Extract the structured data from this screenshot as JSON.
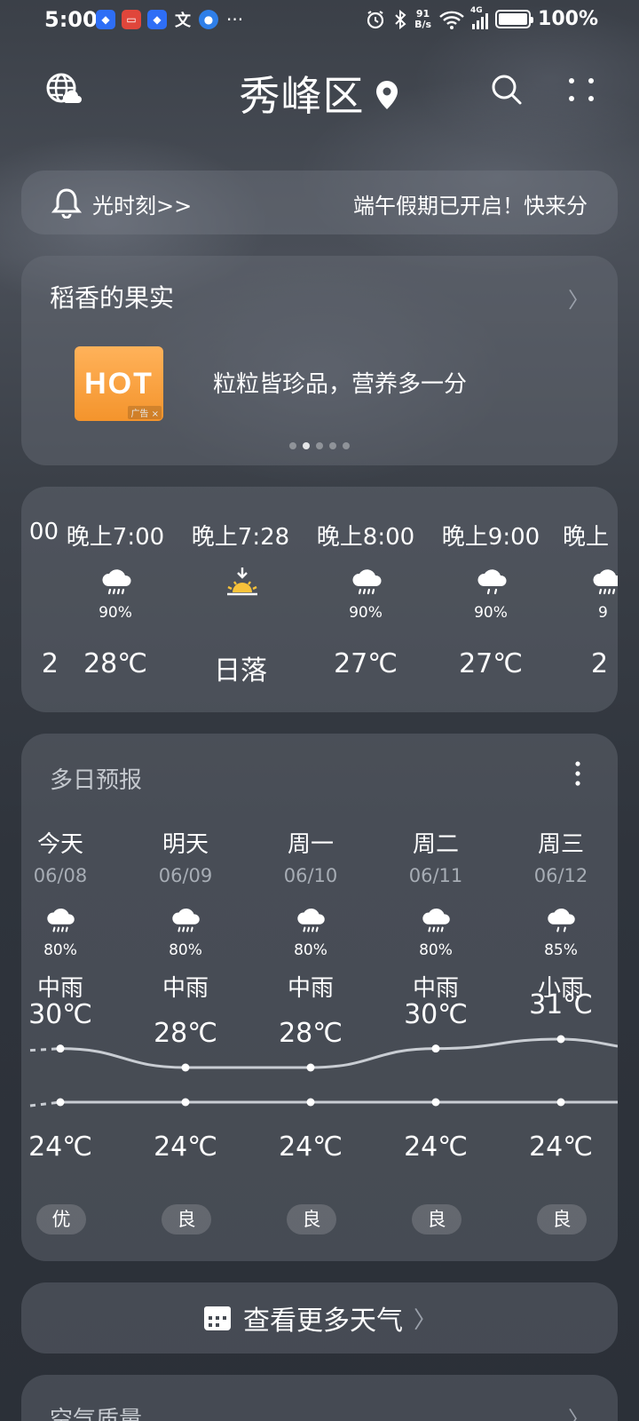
{
  "status_bar": {
    "time": "5:00",
    "net_speed_value": "91",
    "net_speed_unit": "B/s",
    "signal_label": "4G",
    "battery": "100%",
    "battery_level": 1.0
  },
  "header": {
    "title": "秀峰区"
  },
  "notice": {
    "left_text": "光时刻>>",
    "right_text": "端午假期已开启！快来分"
  },
  "ad": {
    "title": "稻香的果实",
    "thumb_text": "HOT",
    "badge": "广告 ×",
    "text": "粒粒皆珍品，营养多一分",
    "dot_count": 5,
    "active_dot": 1
  },
  "hourly": [
    {
      "time": "00",
      "pct": "",
      "temp": "2"
    },
    {
      "time": "晚上7:00",
      "icon": "rain-cloud-icon",
      "pct": "90%",
      "temp": "28℃"
    },
    {
      "time": "晚上7:28",
      "icon": "sunset-icon",
      "pct": "",
      "temp": "日落"
    },
    {
      "time": "晚上8:00",
      "icon": "rain-cloud-icon",
      "pct": "90%",
      "temp": "27℃"
    },
    {
      "time": "晚上9:00",
      "icon": "light-rain-cloud-icon",
      "pct": "90%",
      "temp": "27℃"
    },
    {
      "time": "晚上",
      "icon": "rain-cloud-icon",
      "pct": "9",
      "temp": "2"
    }
  ],
  "forecast": {
    "title": "多日预报",
    "days": [
      {
        "name": "今天",
        "date": "06/08",
        "icon": "rain-cloud-icon",
        "pct": "80%",
        "condition": "中雨",
        "high": "30℃",
        "low": "24℃",
        "aqi": "优",
        "high_value": 30,
        "low_value": 24
      },
      {
        "name": "明天",
        "date": "06/09",
        "icon": "rain-cloud-icon",
        "pct": "80%",
        "condition": "中雨",
        "high": "28℃",
        "low": "24℃",
        "aqi": "良",
        "high_value": 28,
        "low_value": 24
      },
      {
        "name": "周一",
        "date": "06/10",
        "icon": "rain-cloud-icon",
        "pct": "80%",
        "condition": "中雨",
        "high": "28℃",
        "low": "24℃",
        "aqi": "良",
        "high_value": 28,
        "low_value": 24
      },
      {
        "name": "周二",
        "date": "06/11",
        "icon": "rain-cloud-icon",
        "pct": "80%",
        "condition": "中雨",
        "high": "30℃",
        "low": "24℃",
        "aqi": "良",
        "high_value": 30,
        "low_value": 24
      },
      {
        "name": "周三",
        "date": "06/12",
        "icon": "light-rain-cloud-icon",
        "pct": "85%",
        "condition": "小雨",
        "high": "31℃",
        "low": "24℃",
        "aqi": "良",
        "high_value": 31,
        "low_value": 24
      }
    ]
  },
  "more_weather": {
    "label": "查看更多天气"
  },
  "air_quality": {
    "title": "空气质量"
  },
  "colors": {
    "line": "#c9cdd3",
    "sun": "#f7c23a",
    "ad_orange": "#f4942c"
  }
}
